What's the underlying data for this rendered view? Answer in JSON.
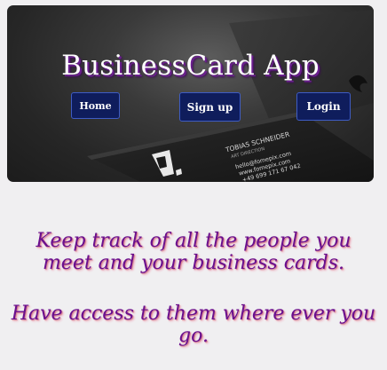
{
  "app": {
    "title": "BusinessCard App"
  },
  "nav": {
    "home_label": "Home",
    "signup_label": "Sign up",
    "login_label": "Login"
  },
  "hero_card_text": {
    "name": "TOBIAS SCHNEIDER",
    "role": "ART DIRECTION",
    "email": "hello@fomepix.com",
    "website": "www.fomepix.com",
    "phone": "+49 699 171 67 042"
  },
  "main": {
    "tagline_1": "Keep track of all the people you meet and your business cards.",
    "tagline_2": "Have access to them where ever you go."
  },
  "colors": {
    "page_background": "#f0eff1",
    "button_fill": "#0f1d5c",
    "button_border": "#3e5cc4",
    "tagline_text": "#6a0f8e",
    "title_shadow": "#6b1f8f"
  }
}
